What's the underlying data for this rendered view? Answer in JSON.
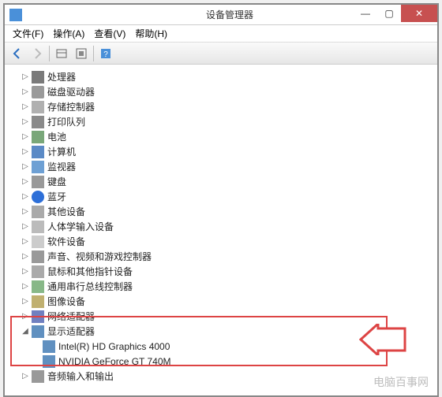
{
  "title": "设备管理器",
  "window_controls": {
    "min": "—",
    "max": "▢",
    "close": "✕"
  },
  "menu": [
    "文件(F)",
    "操作(A)",
    "查看(V)",
    "帮助(H)"
  ],
  "toolbar_icons": [
    "back-icon",
    "forward-icon",
    "grid-icon",
    "options-icon",
    "help-icon"
  ],
  "tree": [
    {
      "label": "处理器",
      "ic": "ic-cpu",
      "arrow": "▷"
    },
    {
      "label": "磁盘驱动器",
      "ic": "ic-disk",
      "arrow": "▷"
    },
    {
      "label": "存储控制器",
      "ic": "ic-storage",
      "arrow": "▷"
    },
    {
      "label": "打印队列",
      "ic": "ic-printer",
      "arrow": "▷"
    },
    {
      "label": "电池",
      "ic": "ic-battery",
      "arrow": "▷"
    },
    {
      "label": "计算机",
      "ic": "ic-pc",
      "arrow": "▷"
    },
    {
      "label": "监视器",
      "ic": "ic-monitor",
      "arrow": "▷"
    },
    {
      "label": "键盘",
      "ic": "ic-kbd",
      "arrow": "▷"
    },
    {
      "label": "蓝牙",
      "ic": "ic-bt",
      "arrow": "▷"
    },
    {
      "label": "其他设备",
      "ic": "ic-other",
      "arrow": "▷"
    },
    {
      "label": "人体学输入设备",
      "ic": "ic-hid",
      "arrow": "▷"
    },
    {
      "label": "软件设备",
      "ic": "ic-sw",
      "arrow": "▷"
    },
    {
      "label": "声音、视频和游戏控制器",
      "ic": "ic-audio",
      "arrow": "▷"
    },
    {
      "label": "鼠标和其他指针设备",
      "ic": "ic-mouse",
      "arrow": "▷"
    },
    {
      "label": "通用串行总线控制器",
      "ic": "ic-usb",
      "arrow": "▷"
    },
    {
      "label": "图像设备",
      "ic": "ic-image",
      "arrow": "▷"
    },
    {
      "label": "网络适配器",
      "ic": "ic-network",
      "arrow": "▷"
    },
    {
      "label": "显示适配器",
      "ic": "ic-display",
      "arrow": "◢",
      "expanded": true,
      "children": [
        {
          "label": "Intel(R) HD Graphics 4000",
          "ic": "ic-gpu"
        },
        {
          "label": "NVIDIA GeForce GT 740M",
          "ic": "ic-gpu"
        }
      ]
    },
    {
      "label": "音频输入和输出",
      "ic": "ic-audio",
      "arrow": "▷"
    }
  ],
  "watermark": "电脑百事网"
}
